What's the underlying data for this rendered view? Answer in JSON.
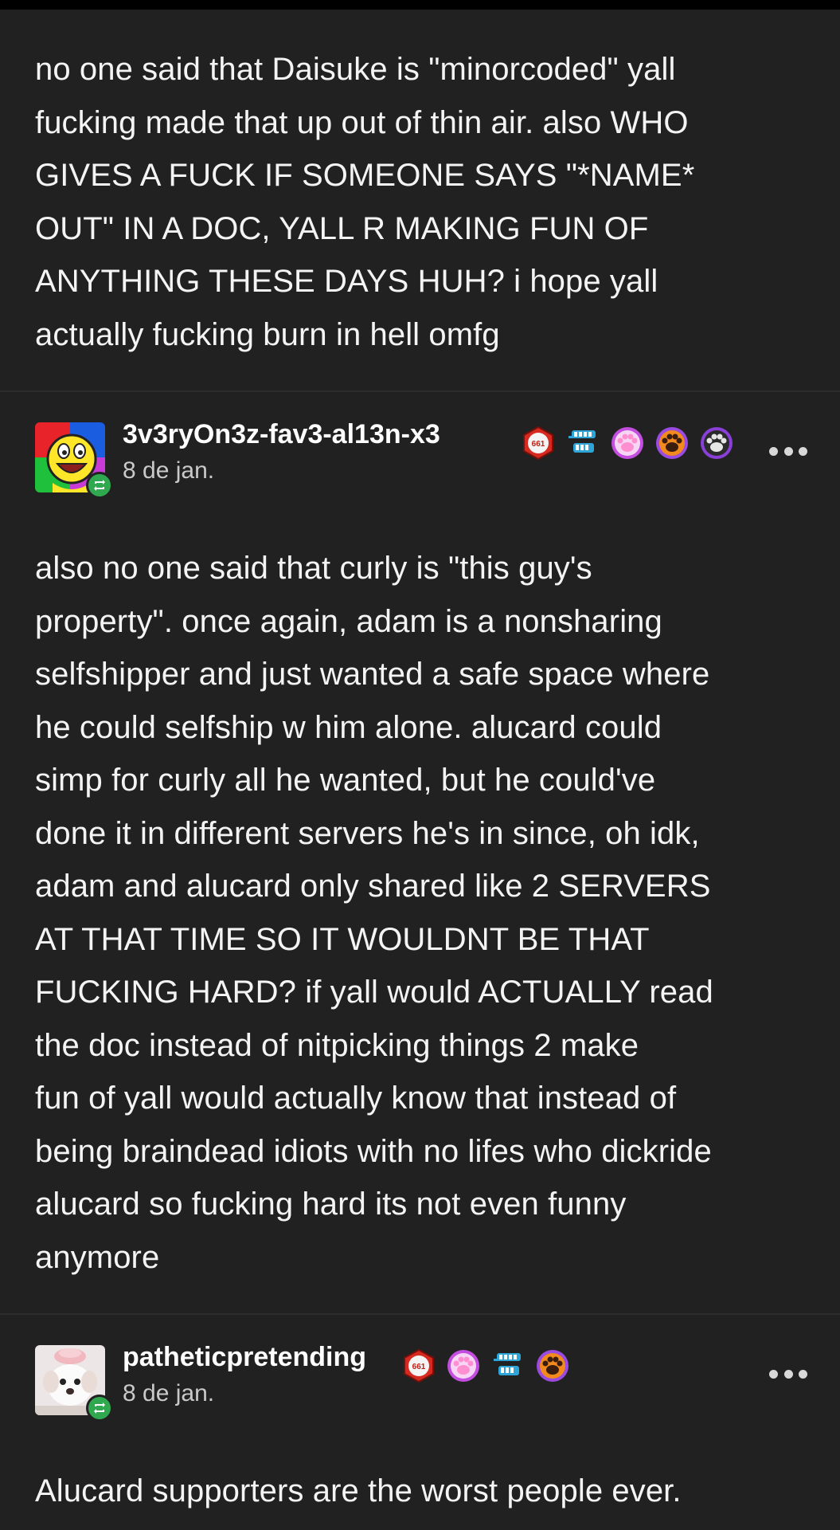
{
  "posts": [
    {
      "body": "no one said that Daisuke is \"minorcoded\" yall\nfucking made that up out of thin air. also WHO\nGIVES A FUCK IF SOMEONE SAYS \"*NAME*\nOUT\" IN A DOC, YALL R MAKING FUN OF\nANYTHING THESE DAYS HUH? i hope yall\nactually fucking burn in hell omfg"
    },
    {
      "username": "3v3ryOn3z-fav3-al13n-x3",
      "date": "8 de jan.",
      "avatar": "smiley-rainbow-avatar",
      "badges": [
        "661-badge-icon",
        "teeth-badge-icon",
        "pink-paw-badge-icon",
        "orange-paw-badge-icon",
        "purple-paw-badge-icon"
      ],
      "body": "also no one said that curly is \"this guy's\nproperty\". once again, adam is a nonsharing\nselfshipper and just wanted a safe space where\nhe could selfship w him alone. alucard could\nsimp for curly all he wanted, but he could've\ndone it in different servers he's in since, oh idk,\nadam and alucard only shared like 2 SERVERS\nAT THAT TIME SO IT WOULDNT BE THAT\nFUCKING HARD? if yall would ACTUALLY read\nthe doc instead of nitpicking things 2 make\nfun of yall would actually know that instead of\nbeing braindead idiots with no lifes who dickride\nalucard so fucking hard its not even funny\nanymore"
    },
    {
      "username": "patheticpretending",
      "date": "8 de jan.",
      "avatar": "puppy-avatar",
      "badges": [
        "661-badge-icon",
        "pink-paw-badge-icon",
        "teeth-badge-icon",
        "orange-paw-badge-icon"
      ],
      "body": "Alucard supporters are the worst people ever."
    }
  ],
  "colors": {
    "background": "#212121",
    "text": "#f4f4f4",
    "reblog_green": "#2fa850"
  }
}
